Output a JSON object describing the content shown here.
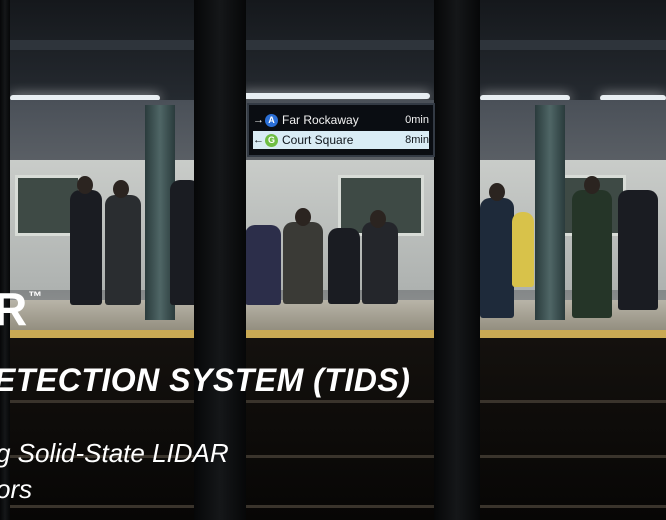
{
  "sign": {
    "row1": {
      "arrow": "→",
      "line": "A",
      "line_color": "#2b6fd6",
      "destination": "Far Rockaway",
      "minutes": "0min"
    },
    "row2": {
      "arrow": "←",
      "line": "G",
      "line_color": "#6fbe44",
      "destination": "Court Square",
      "minutes": "8min"
    }
  },
  "overlay": {
    "brand": "R",
    "trademark": "™",
    "headline": "ETECTION SYSTEM (TIDS)",
    "subtitle_line1": "g Solid-State LIDAR",
    "subtitle_line2": "ors"
  }
}
